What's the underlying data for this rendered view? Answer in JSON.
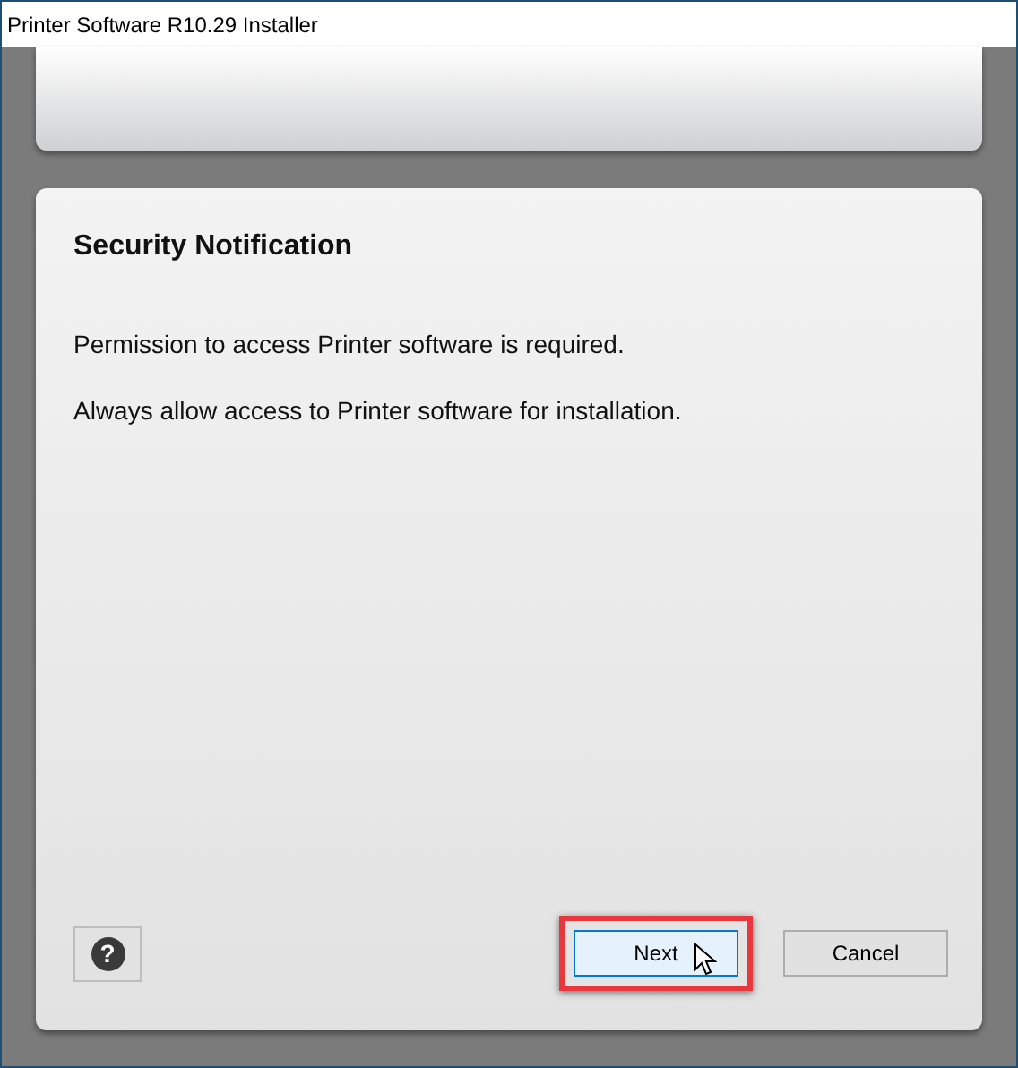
{
  "window": {
    "title": "Printer Software R10.29 Installer"
  },
  "notification": {
    "heading": "Security Notification",
    "paragraphs": [
      "Permission to access Printer software is required.",
      "Always allow access to Printer software for installation."
    ]
  },
  "help_button": {
    "label": "?"
  },
  "buttons": [
    {
      "label": "Next",
      "default": true,
      "highlighted": true
    },
    {
      "label": "Cancel",
      "default": false,
      "highlighted": false
    }
  ]
}
